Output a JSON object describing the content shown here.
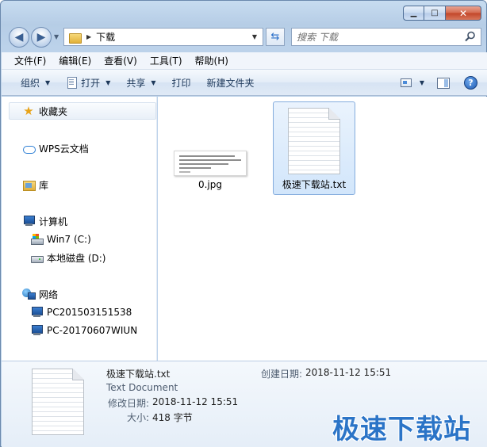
{
  "window": {
    "caption": {
      "minimize": "▁",
      "maximize": "□",
      "close": "✕"
    }
  },
  "address": {
    "path": "下载",
    "back_icon": "back-arrow-icon",
    "forward_icon": "forward-arrow-icon"
  },
  "search": {
    "placeholder": "搜索 下载"
  },
  "menu": [
    "文件(F)",
    "编辑(E)",
    "查看(V)",
    "工具(T)",
    "帮助(H)"
  ],
  "toolbar": {
    "organize": "组织",
    "open": "打开",
    "share": "共享",
    "print": "打印",
    "new_folder": "新建文件夹",
    "help": "?"
  },
  "nav": {
    "favorites": "收藏夹",
    "wps": "WPS云文档",
    "libraries": "库",
    "computer": "计算机",
    "drive_c": "Win7 (C:)",
    "drive_d": "本地磁盘 (D:)",
    "network": "网络",
    "pc1": "PC201503151538",
    "pc2": "PC-20170607WIUN"
  },
  "files": [
    {
      "name": "0.jpg",
      "type": "image",
      "selected": false
    },
    {
      "name": "极速下载站.txt",
      "type": "text",
      "selected": true
    }
  ],
  "details": {
    "name": "极速下载站.txt",
    "type": "Text Document",
    "modified_label": "修改日期:",
    "modified_value": "2018-11-12 15:51",
    "size_label": "大小:",
    "size_value": "418 字节",
    "created_label": "创建日期:",
    "created_value": "2018-11-12 15:51"
  },
  "watermark": "极速下载站",
  "colors": {
    "accent": "#2b74c7",
    "selection": "#d2e6fb",
    "chrome": "#bcd2ea"
  }
}
